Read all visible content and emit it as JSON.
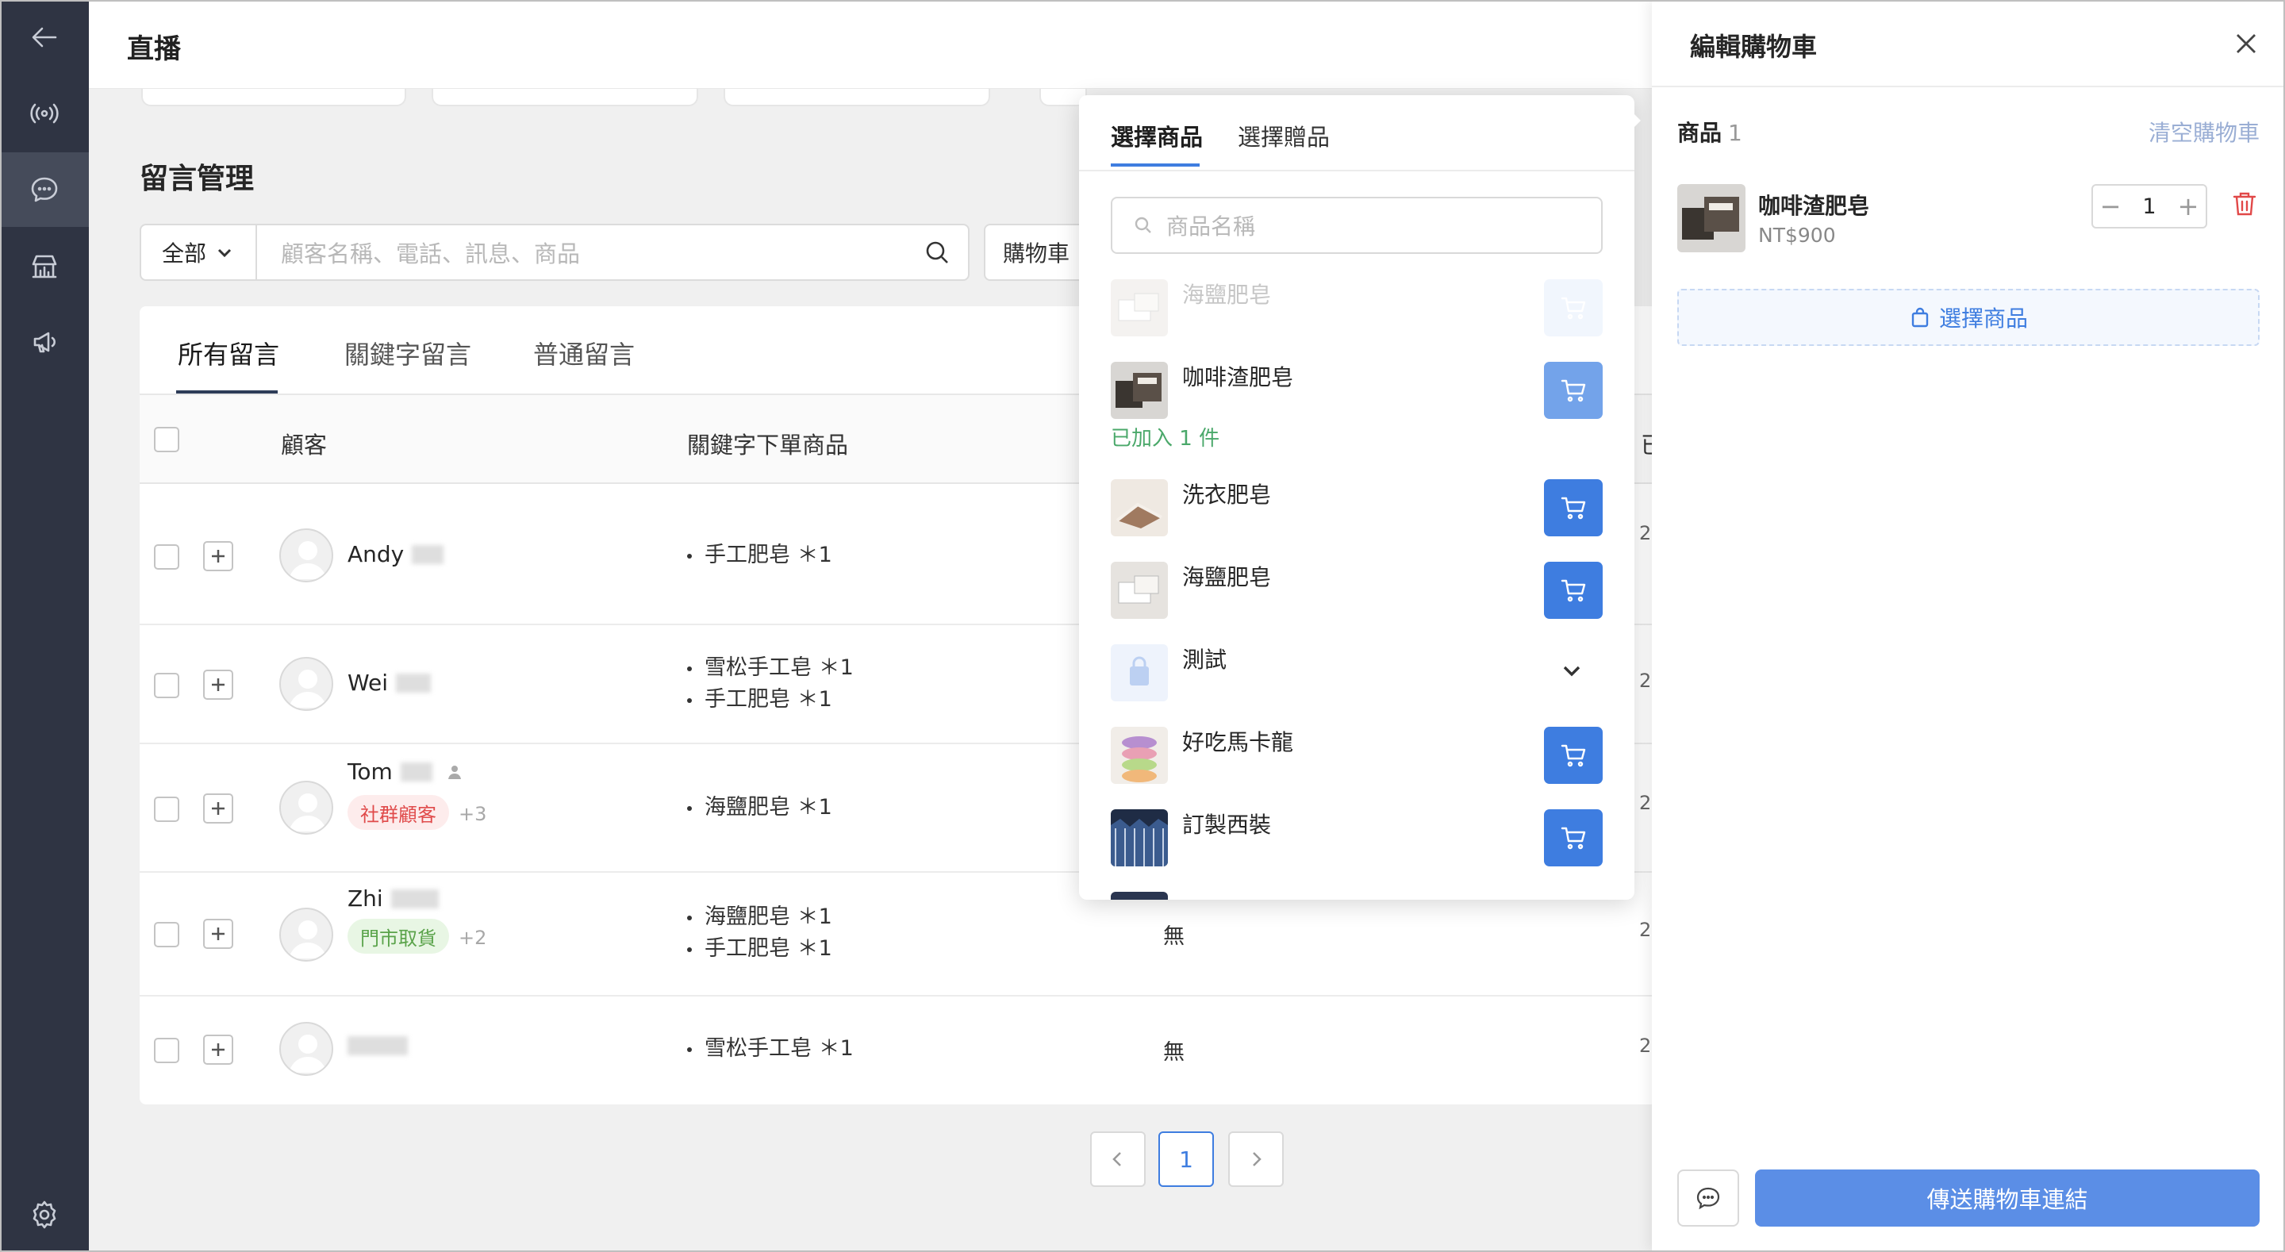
{
  "sidebar": {
    "items": [
      {
        "icon": "arrow-left-icon"
      },
      {
        "icon": "live-broadcast-icon"
      },
      {
        "icon": "chat-bubble-icon"
      },
      {
        "icon": "shop-stats-icon"
      },
      {
        "icon": "megaphone-icon"
      },
      {
        "icon": "gear-icon"
      }
    ]
  },
  "header": {
    "title": "直播"
  },
  "main": {
    "section_title": "留言管理",
    "filter_value": "全部",
    "search_placeholder": "顧客名稱、電話、訊息、商品",
    "cart_filter": "購物車",
    "tabs": [
      {
        "label": "所有留言"
      },
      {
        "label": "關鍵字留言"
      },
      {
        "label": "普通留言"
      }
    ],
    "columns": {
      "customer": "顧客",
      "keyword_items": "關鍵字下單商品",
      "partial": "已"
    },
    "rows": [
      {
        "name": "Andy",
        "tag": "",
        "tag_more": "",
        "items": [
          "手工肥皂 ＊1"
        ],
        "cart": ""
      },
      {
        "name": "Wei",
        "tag": "",
        "tag_more": "",
        "items": [
          "雪松手工皂 ＊1",
          "手工肥皂 ＊1"
        ],
        "cart": ""
      },
      {
        "name": "Tom",
        "tag": "社群顧客",
        "tag_more": "+3",
        "items": [
          "海鹽肥皂 ＊1"
        ],
        "cart": ""
      },
      {
        "name": "Zhi",
        "tag": "門市取貨",
        "tag_more": "+2",
        "items": [
          "海鹽肥皂 ＊1",
          "手工肥皂 ＊1"
        ],
        "cart": "無"
      },
      {
        "name": "",
        "tag": "",
        "tag_more": "",
        "items": [
          "雪松手工皂 ＊1"
        ],
        "cart": "無"
      }
    ],
    "row_partial_values": [
      "2",
      "2",
      "2",
      "2",
      "2"
    ],
    "pagination": {
      "current": "1"
    }
  },
  "picker": {
    "tabs": [
      {
        "label": "選擇商品"
      },
      {
        "label": "選擇贈品"
      }
    ],
    "search_placeholder": "商品名稱",
    "added_note": "已加入 1 件",
    "products": [
      {
        "name": "海鹽肥皂",
        "state": "faded"
      },
      {
        "name": "咖啡渣肥皂",
        "state": "half"
      },
      {
        "name": "洗衣肥皂",
        "state": "normal"
      },
      {
        "name": "海鹽肥皂",
        "state": "normal"
      },
      {
        "name": "測試",
        "state": "expand"
      },
      {
        "name": "好吃馬卡龍",
        "state": "normal"
      },
      {
        "name": "訂製西裝",
        "state": "normal"
      }
    ]
  },
  "drawer": {
    "title": "編輯購物車",
    "cart_label": "商品",
    "cart_count": "1",
    "clear_label": "清空購物車",
    "item": {
      "name": "咖啡渣肥皂",
      "price": "NT$900",
      "qty": "1"
    },
    "select_products": "選擇商品",
    "send_button": "傳送購物車連結"
  },
  "colors": {
    "sidebar_bg": "#2f3443",
    "primary": "#3e7de0",
    "danger": "#e14848",
    "success": "#4aa86a"
  }
}
